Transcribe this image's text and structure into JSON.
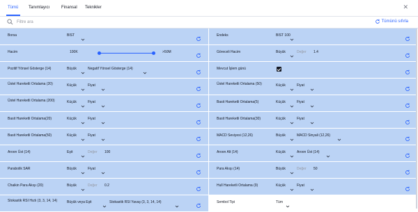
{
  "tabs": [
    "Tümü",
    "Tanımlayıcı",
    "Finansal",
    "Teknikler"
  ],
  "search": {
    "placeholder": "Filtre ara",
    "reset_label": "Tümünü sıfırla"
  },
  "rows": [
    {
      "left": {
        "label": "Borsa",
        "v1": "BIST"
      },
      "right": {
        "label": "Endeks",
        "v1": "BIST 100"
      }
    },
    {
      "left": {
        "label": "Hacim",
        "min": "100K",
        "max": ">50M",
        "slider_from": 0.1,
        "slider_to": 1.0
      },
      "right": {
        "label": "Göreceli Hacim",
        "v1": "Büyük",
        "ph": "Değer",
        "num": "1.4"
      }
    },
    {
      "left": {
        "label": "Pozitif Yönsel Gösterge (14)",
        "v1": "Büyük",
        "v2": "Negatif Yönsel Gösterge (14)"
      },
      "right": {
        "label": "Mevcut İşlem günü",
        "checked": true
      }
    },
    {
      "left": {
        "label": "Üstel Hareketli Ortalama (20)",
        "v1": "Küçük",
        "v2": "Fiyat"
      },
      "right": {
        "label": "Üstel Hareketli Ortalama (50)",
        "v1": "Küçük",
        "v2": "Fiyat"
      }
    },
    {
      "left": {
        "label": "Üstel Hareketli Ortalama (200)",
        "v1": "Küçük",
        "v2": "Fiyat"
      },
      "right": {
        "label": "Basit Hareketli Ortalama(5)",
        "v1": "Küçük",
        "v2": "Fiyat"
      }
    },
    {
      "left": {
        "label": "Basit Hareketli Ortalama(20)",
        "v1": "Küçük",
        "v2": "Fiyat"
      },
      "right": {
        "label": "Basit Hareketli Ortalama(30)",
        "v1": "Küçük",
        "v2": "Fiyat"
      }
    },
    {
      "left": {
        "label": "Basit Hareketli Ortalama(50)",
        "v1": "Küçük",
        "v2": "Fiyat"
      },
      "right": {
        "label": "MACD Seviyesi (12,26)",
        "v1": "Büyük",
        "v2": "MACD Sinyali (12,26)"
      }
    },
    {
      "left": {
        "label": "Aroon Üst (14)",
        "v1": "Eşit",
        "ph": "Değer",
        "num": "100"
      },
      "right": {
        "label": "Aroon Alt (14)",
        "v1": "Küçük",
        "v2": "Aroon Üst (14)"
      }
    },
    {
      "left": {
        "label": "Parabolik SAR",
        "v1": "Büyük",
        "v2": "Fiyat"
      },
      "right": {
        "label": "Para Akışı (14)",
        "v1": "Büyük",
        "ph": "Değer",
        "num": "50"
      }
    },
    {
      "left": {
        "label": "Chaikin Para Akışı (20)",
        "v1": "Büyük",
        "ph": "Değer",
        "num": "0.2"
      },
      "right": {
        "label": "Hull Hareketli Ortalama (9)",
        "v1": "Küçük",
        "v2": "Fiyat"
      }
    },
    {
      "left": {
        "label": "Stokastik RSI Hızlı (3, 3, 14, 14)",
        "v1": "Büyük veya Eşit",
        "v2": "Stokastik RSI Yavaş (3, 3, 14, 14)"
      },
      "right": {
        "label": "Sembol Tipi",
        "v1": "Tüm",
        "white": true
      }
    }
  ]
}
